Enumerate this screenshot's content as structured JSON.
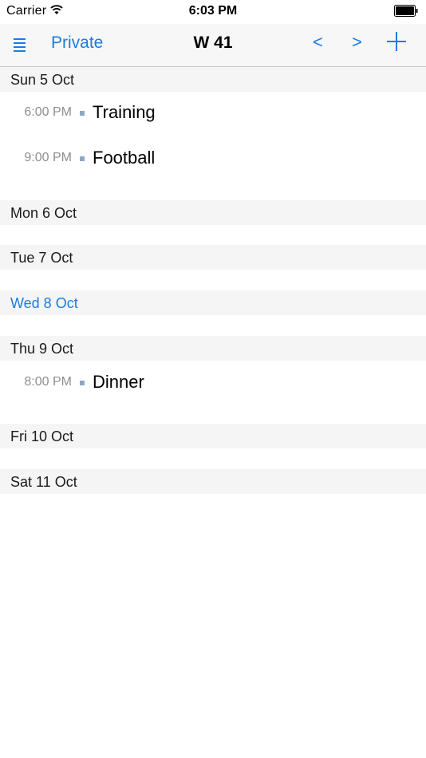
{
  "status_bar": {
    "carrier": "Carrier",
    "time": "6:03 PM",
    "wifi_icon": "wifi-icon",
    "battery_icon": "battery-icon"
  },
  "navbar": {
    "menu_icon": "list-menu-icon",
    "calendar_name": "Private",
    "title": "W 41",
    "prev_label": "<",
    "next_label": ">",
    "add_icon": "plus-icon",
    "accent_color": "#1a7ce2"
  },
  "days": [
    {
      "label": "Sun 5 Oct",
      "today": false,
      "events": [
        {
          "time": "6:00 PM",
          "title": "Training"
        },
        {
          "time": "9:00 PM",
          "title": "Football"
        }
      ]
    },
    {
      "label": "Mon 6 Oct",
      "today": false,
      "events": []
    },
    {
      "label": "Tue 7 Oct",
      "today": false,
      "events": []
    },
    {
      "label": "Wed 8 Oct",
      "today": true,
      "events": []
    },
    {
      "label": "Thu 9 Oct",
      "today": false,
      "events": [
        {
          "time": "8:00 PM",
          "title": "Dinner"
        }
      ]
    },
    {
      "label": "Fri 10 Oct",
      "today": false,
      "events": []
    },
    {
      "label": "Sat 11 Oct",
      "today": false,
      "events": []
    }
  ]
}
